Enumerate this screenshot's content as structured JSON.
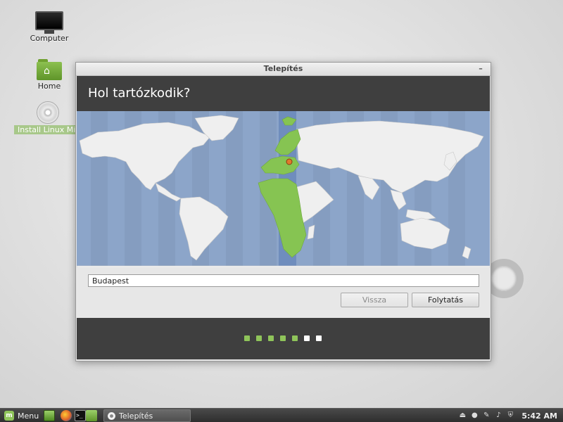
{
  "desktop": {
    "icons": [
      {
        "label": "Computer",
        "icon": "computer-icon"
      },
      {
        "label": "Home",
        "icon": "home-folder-icon"
      },
      {
        "label": "Install Linux Mint",
        "icon": "disc-icon"
      }
    ]
  },
  "window": {
    "title": "Telepítés",
    "minimize_label": "–",
    "heading": "Hol tartózkodik?",
    "location_value": "Budapest",
    "back_label": "Vissza",
    "continue_label": "Folytatás",
    "progress": {
      "total": 7,
      "completed": 5
    }
  },
  "colors": {
    "ocean": "#8ca5c9",
    "land": "#efefef",
    "highlight": "#86c452",
    "timezone_band": "#6f8dbd",
    "header": "#3f3f3f"
  },
  "taskbar": {
    "menu_label": "Menu",
    "task_label": "Telepítés",
    "clock": "5:42 AM",
    "tray_icons": [
      "eject-icon",
      "user-icon",
      "network-icon",
      "volume-icon",
      "update-icon"
    ]
  }
}
